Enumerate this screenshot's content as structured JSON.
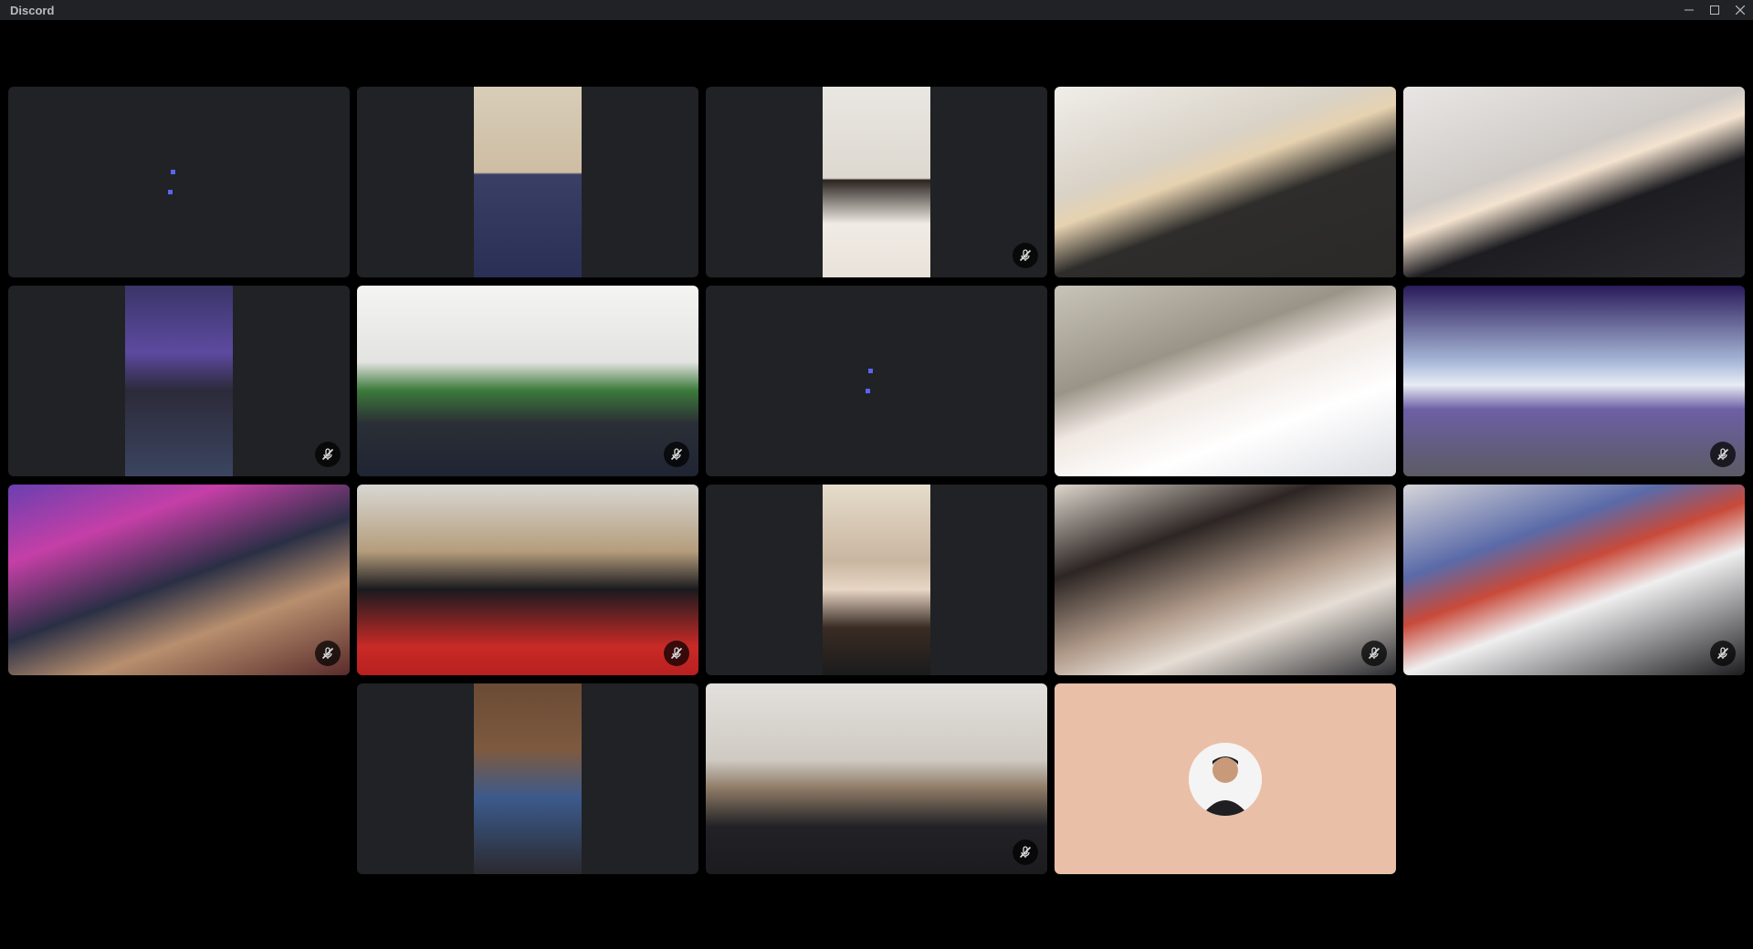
{
  "window": {
    "title": "Discord",
    "controls": [
      "minimize-icon",
      "maximize-icon",
      "close-icon"
    ]
  },
  "call": {
    "tiles": [
      {
        "video": "none",
        "muted": false
      },
      {
        "video": "portrait",
        "muted": false
      },
      {
        "video": "portrait",
        "muted": true
      },
      {
        "video": "full",
        "muted": false
      },
      {
        "video": "full",
        "muted": false
      },
      {
        "video": "portrait",
        "muted": true
      },
      {
        "video": "full",
        "muted": true
      },
      {
        "video": "none",
        "muted": false
      },
      {
        "video": "full",
        "muted": false
      },
      {
        "video": "full",
        "muted": true
      },
      {
        "video": "full",
        "muted": true
      },
      {
        "video": "full",
        "muted": true
      },
      {
        "video": "portrait",
        "muted": false
      },
      {
        "video": "full",
        "muted": true
      },
      {
        "video": "full",
        "muted": true
      },
      {
        "video": "none",
        "muted": false
      },
      {
        "video": "portrait",
        "muted": false
      },
      {
        "video": "full",
        "muted": true
      },
      {
        "video": "avatar",
        "muted": false
      }
    ]
  },
  "colors": {
    "titlebar": "#202225",
    "tile_bg": "#202225",
    "speaking_dots": "#5865f2",
    "avatar_tile_bg": "#eabfa8"
  }
}
